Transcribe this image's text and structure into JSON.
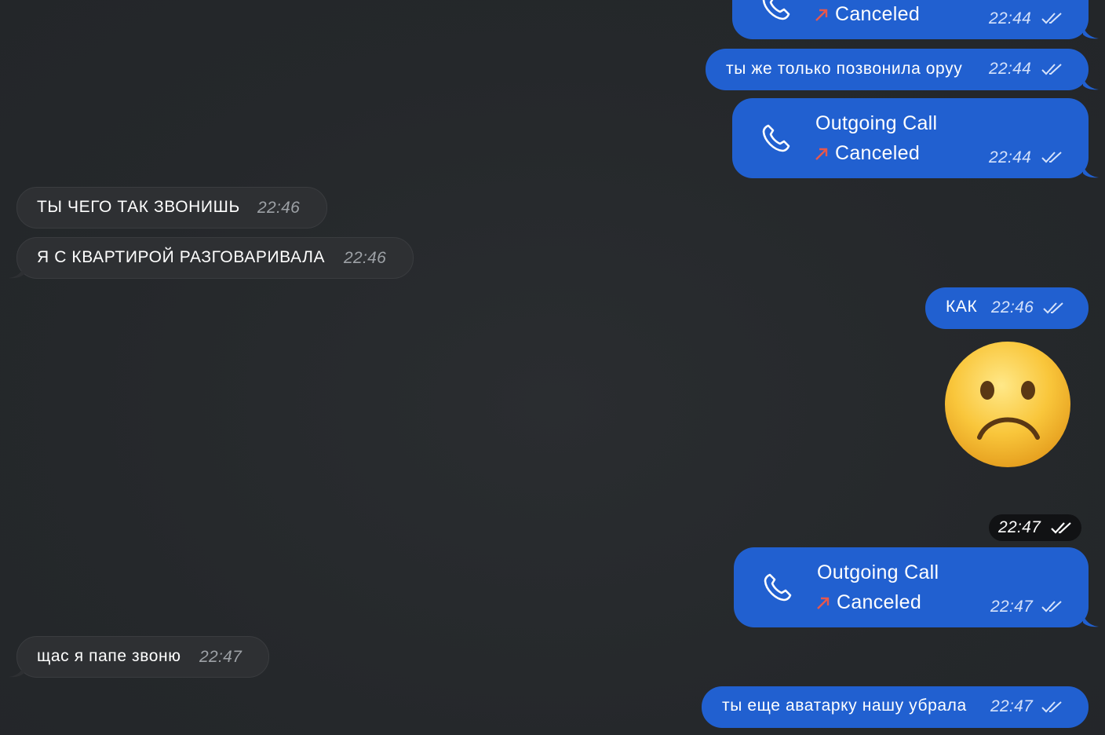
{
  "colors": {
    "background": "#25282b",
    "outgoing_bubble": "#2160d0",
    "incoming_bubble": "#2e3033",
    "canceled_arrow": "#e6574d"
  },
  "messages": [
    {
      "kind": "call",
      "direction": "outgoing",
      "title": "",
      "status": "Canceled",
      "time": "22:44",
      "read": true
    },
    {
      "kind": "text",
      "direction": "outgoing",
      "text": "ты же только позвонила оруу",
      "time": "22:44",
      "read": true
    },
    {
      "kind": "call",
      "direction": "outgoing",
      "title": "Outgoing Call",
      "status": "Canceled",
      "time": "22:44",
      "read": true
    },
    {
      "kind": "text",
      "direction": "incoming",
      "text": "ТЫ ЧЕГО ТАК ЗВОНИШЬ",
      "time": "22:46"
    },
    {
      "kind": "text",
      "direction": "incoming",
      "text": "Я С КВАРТИРОЙ РАЗГОВАРИВАЛА",
      "time": "22:46"
    },
    {
      "kind": "text",
      "direction": "outgoing",
      "text": "КАК",
      "time": "22:46",
      "read": true
    },
    {
      "kind": "emoji",
      "direction": "outgoing",
      "emoji": "frowning-face",
      "time": "22:47",
      "read": true
    },
    {
      "kind": "call",
      "direction": "outgoing",
      "title": "Outgoing Call",
      "status": "Canceled",
      "time": "22:47",
      "read": true
    },
    {
      "kind": "text",
      "direction": "incoming",
      "text": "щас я папе звоню",
      "time": "22:47"
    },
    {
      "kind": "text",
      "direction": "outgoing",
      "text": "ты еще аватарку нашу убрала",
      "time": "22:47",
      "read": true
    }
  ]
}
